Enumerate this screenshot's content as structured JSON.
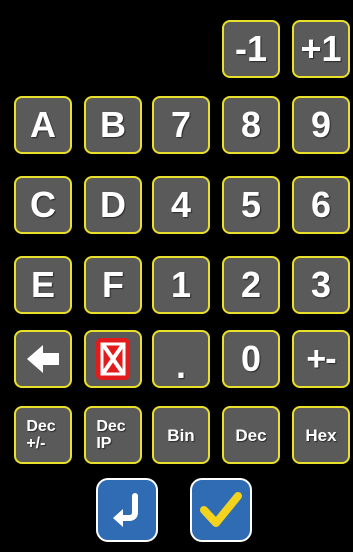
{
  "keypad": {
    "row0": {
      "minus_one": "-1",
      "plus_one": "+1"
    },
    "row1": {
      "a": "A",
      "b": "B",
      "seven": "7",
      "eight": "8",
      "nine": "9"
    },
    "row2": {
      "c": "C",
      "d": "D",
      "four": "4",
      "five": "5",
      "six": "6"
    },
    "row3": {
      "e": "E",
      "f": "F",
      "one": "1",
      "two": "2",
      "three": "3"
    },
    "row4": {
      "backspace_icon": "arrow-left-icon",
      "delete_icon": "delete-x-icon",
      "dot": ".",
      "zero": "0",
      "plus_minus": "+-"
    },
    "row5": {
      "dec_sign": "Dec\n+/-",
      "dec_ip": "Dec\nIP",
      "bin": "Bin",
      "dec": "Dec",
      "hex": "Hex"
    },
    "actions": {
      "enter_icon": "return-arrow-icon",
      "ok_icon": "checkmark-icon"
    }
  },
  "colors": {
    "background": "#000000",
    "key_fill": "#5a5a5a",
    "key_border": "#e8e02a",
    "key_text": "#ffffff",
    "delete_red": "#e41b1b",
    "action_blue": "#2f6cb4",
    "check_yellow": "#f3d31b"
  }
}
